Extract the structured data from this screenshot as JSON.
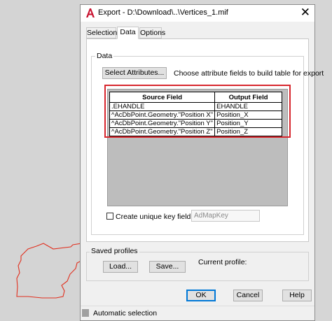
{
  "window": {
    "title": "Export - D:\\Download\\..\\Vertices_1.mif",
    "close_glyph": "✕"
  },
  "tabs": [
    {
      "label": "Selection",
      "active": false
    },
    {
      "label": "Data",
      "active": true
    },
    {
      "label": "Options",
      "active": false
    }
  ],
  "data_group": {
    "label": "Data",
    "select_button": "Select Attributes...",
    "hint": "Choose attribute fields to build table for export"
  },
  "field_table": {
    "headers": [
      "Source Field",
      "Output Field"
    ],
    "rows": [
      [
        ".EHANDLE",
        "EHANDLE"
      ],
      [
        "^AcDbPoint.Geometry.\"Position X\"",
        "Position_X"
      ],
      [
        "^AcDbPoint.Geometry.\"Position Y\"",
        "Position_Y"
      ],
      [
        "^AcDbPoint.Geometry.\"Position Z\"",
        "Position_Z"
      ]
    ]
  },
  "unique_key": {
    "label": "Create unique key field:",
    "value": "AdMapKey",
    "checked": false
  },
  "saved_profiles": {
    "label": "Saved profiles",
    "load_button": "Load...",
    "save_button": "Save...",
    "current_label": "Current profile:"
  },
  "footer": {
    "ok": "OK",
    "cancel": "Cancel",
    "help": "Help"
  },
  "statusbar": {
    "text": "Automatic selection"
  },
  "colors": {
    "highlight_red": "#d7262d",
    "default_button_blue": "#0078d7",
    "app_icon_red": "#c8102e"
  },
  "icons": {
    "app": "autocad-icon",
    "close": "close-icon"
  }
}
